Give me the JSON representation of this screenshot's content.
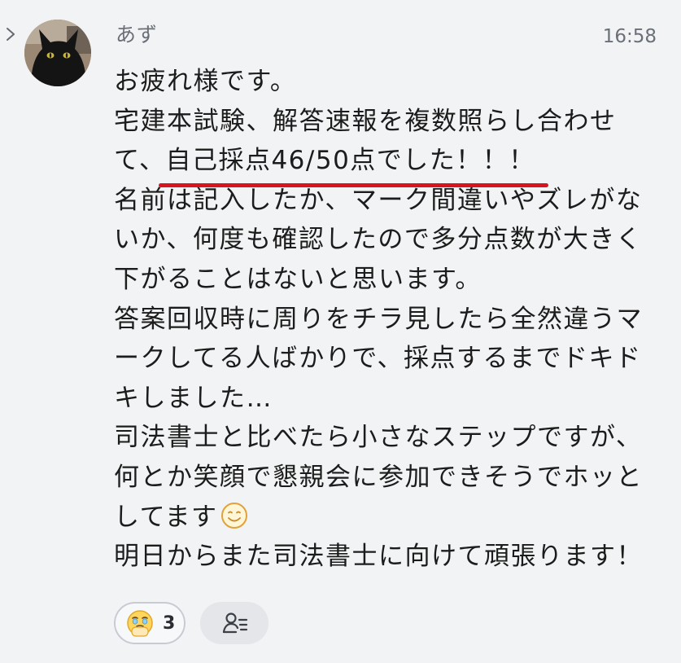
{
  "message": {
    "sender": "あず",
    "time": "16:58",
    "lines": {
      "l1": "お疲れ様です。",
      "l2": "宅建本試験、解答速報を複数照らし合わせ",
      "l3_prefix": "て、",
      "l3_highlight": "自己採点46/50点でした！！！",
      "l4": "名前は記入したか、マーク間違いやズレがな",
      "l5": "いか、何度も確認したので多分点数が大きく",
      "l6": "下がることはないと思います。",
      "l7": "答案回収時に周りをチラ見したら全然違うマ",
      "l8": "ークしてる人ばかりで、採点するまでドキド",
      "l9": "キしました…",
      "l10": "司法書士と比べたら小さなステップですが、",
      "l11": "何とか笑顔で懇親会に参加できそうでホッと",
      "l12": "してます",
      "l13": "明日からまた司法書士に向けて頑張ります！"
    },
    "inline_icon": "smiling-face-icon",
    "highlight_underline_color": "#d8141e"
  },
  "reactions": {
    "count": "3",
    "emoji_icon": "face-holding-back-tears-icon"
  },
  "icons": {
    "expand": "chevron-right-icon",
    "avatar": "black-cat-avatar",
    "readers": "reader-list-icon"
  },
  "colors": {
    "background": "#f2f3f4",
    "meta_text": "#6b6f78",
    "body_text": "#1c1c1c"
  }
}
